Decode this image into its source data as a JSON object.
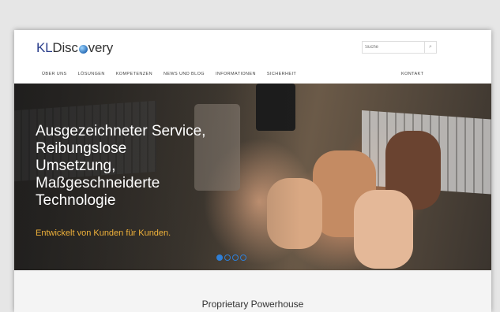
{
  "header": {
    "logo_prefix": "KL",
    "logo_mid": "Disc",
    "logo_suffix": "very",
    "search_placeholder": "Suche"
  },
  "nav": {
    "items": [
      "ÜBER UNS",
      "LÖSUNGEN",
      "KOMPETENZEN",
      "NEWS UND BLOG",
      "INFORMATIONEN",
      "SICHERHEIT"
    ],
    "contact": "KONTAKT"
  },
  "hero": {
    "headline_lines": [
      "Ausgezeichneter Service,",
      "Reibungslose",
      "Umsetzung,",
      "Maßgeschneiderte",
      "Technologie"
    ],
    "subline": "Entwickelt von Kunden für Kunden.",
    "slide_count": 4,
    "active_slide": 1
  },
  "section": {
    "title": "Proprietary Powerhouse"
  },
  "colors": {
    "accent_blue": "#2f7fd6",
    "subline_orange": "#f0b23a",
    "logo_blue": "#2b3f8c"
  }
}
